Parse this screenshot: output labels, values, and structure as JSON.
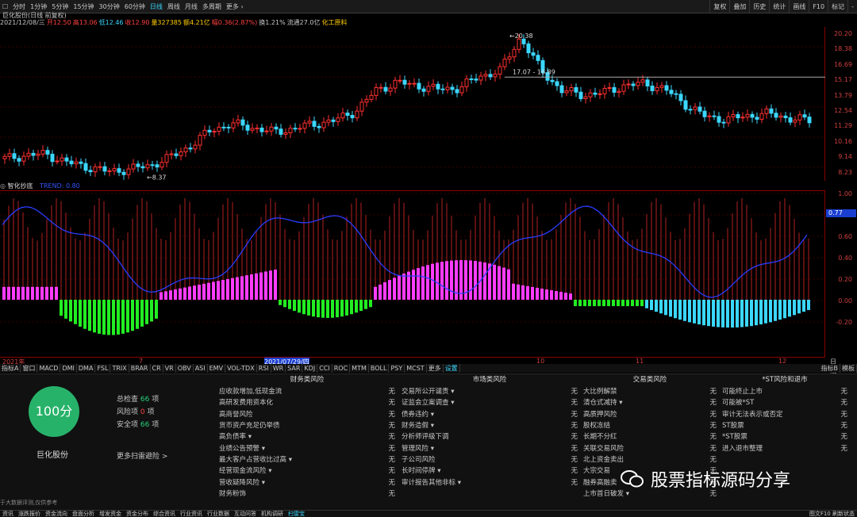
{
  "toolbar": {
    "left": [
      "分时",
      "1分钟",
      "5分钟",
      "15分钟",
      "30分钟",
      "60分钟",
      "日线",
      "周线",
      "月线",
      "多周期",
      "更多 ›"
    ],
    "right": [
      "复权",
      "叠加",
      "历史",
      "统计",
      "画线",
      "F10",
      "标记",
      "-"
    ]
  },
  "main_title": "巨化股份(日线 前复权)",
  "info": [
    "2021/12/08/三",
    "开12.50",
    "高13.06",
    "低12.46",
    "收12.90",
    "量327385",
    "额4.21亿",
    "幅0.36(2.87%)",
    "换1.21%",
    "流通27.0亿",
    "化工原料"
  ],
  "price_labels": [
    "20.20",
    "18.38",
    "16.69",
    "15.17",
    "13.79",
    "12.54",
    "11.29",
    "10.16",
    "9.14",
    "8.23"
  ],
  "price_annotations": {
    "high": "20.38",
    "low": "8.37",
    "range": "17.07 - 16.89"
  },
  "indicator_title": "智化抄底",
  "indicator_value": "TREND: 0.80",
  "ind_labels": [
    "1.00",
    "0.80",
    "0.60",
    "0.40",
    "0.20",
    "0.00",
    "-0.20"
  ],
  "ind_badge": "0.77",
  "xaxis_labels": [
    "2021年",
    "7",
    "2021/07/29/四",
    "10",
    "11",
    "12",
    "日线"
  ],
  "tabs": [
    "指标A",
    "窗口",
    "MACD",
    "DMI",
    "DMA",
    "FSL",
    "TRIX",
    "BRAR",
    "CR",
    "VR",
    "OBV",
    "ASI",
    "EMV",
    "VOL-TDX",
    "RSI",
    "WR",
    "SAR",
    "KDJ",
    "CCI",
    "ROC",
    "MTM",
    "BOLL",
    "PSY",
    "MCST",
    "更多",
    "设置"
  ],
  "tab_right": [
    "指标B",
    "模板"
  ],
  "score": "100分",
  "stock_name": "巨化股份",
  "stats": [
    {
      "label": "总检查",
      "value": "66",
      "unit": "项"
    },
    {
      "label": "风险项",
      "value": "0",
      "unit": "项"
    },
    {
      "label": "安全项",
      "value": "66",
      "unit": "项"
    }
  ],
  "more_link": "更多扫雷避险 >",
  "footnote": "于大数据评测,仅供参考",
  "risk_columns": [
    {
      "title": "财务类风险",
      "items": [
        [
          "应收款增加,低现金流",
          "无"
        ],
        [
          "高研发费用资本化",
          "无"
        ],
        [
          "高商誉风险",
          "无"
        ],
        [
          "货币资产充足仍举债",
          "无"
        ],
        [
          "高负债率 ▾",
          "无"
        ],
        [
          "业绩公告预警 ▾",
          "无"
        ],
        [
          "最大客户占营收比过高 ▾",
          "无"
        ],
        [
          "经营现金流风险 ▾",
          "无"
        ],
        [
          "营收疑降风险 ▾",
          "无"
        ],
        [
          "财务粉饰",
          "无"
        ]
      ]
    },
    {
      "title": "市场类风险",
      "items": [
        [
          "交易所公开谴责 ▾",
          "无"
        ],
        [
          "证监会立案调查 ▾",
          "无"
        ],
        [
          "债券违约 ▾",
          "无"
        ],
        [
          "财务造假 ▾",
          "无"
        ],
        [
          "分析师评级下调",
          "无"
        ],
        [
          "管理风险 ▾",
          "无"
        ],
        [
          "子公司风险",
          "无"
        ],
        [
          "长时间停牌 ▾",
          "无"
        ],
        [
          "审计报告其他非标 ▾",
          "无"
        ]
      ]
    },
    {
      "title": "交易类风险",
      "items": [
        [
          "大比例解禁",
          "无"
        ],
        [
          "清仓式减持 ▾",
          "无"
        ],
        [
          "高质押风险",
          "无"
        ],
        [
          "股权冻结",
          "无"
        ],
        [
          "长期不分红",
          "无"
        ],
        [
          "关联交易风险",
          "无"
        ],
        [
          "北上资金卖出",
          "无"
        ],
        [
          "大宗交易",
          "无"
        ],
        [
          "融券高融卖",
          "无"
        ],
        [
          "上市首日破发 ▾",
          "无"
        ]
      ]
    },
    {
      "title": "*ST风险和退市",
      "items": [
        [
          "可能终止上市",
          "无"
        ],
        [
          "可能被*ST",
          "无"
        ],
        [
          "审计无法表示或否定",
          "无"
        ],
        [
          "ST股票",
          "无"
        ],
        [
          "*ST股票",
          "无"
        ],
        [
          "进入退市整理",
          "无"
        ]
      ]
    }
  ],
  "watermark": "股票指标源码分享",
  "statusbar": [
    "资讯",
    "涨跌报价",
    "资金流向",
    "盘面分析",
    "增发资金",
    "资金分布",
    "综合资讯",
    "行业资讯",
    "行业数据",
    "互动问答",
    "机构调研",
    "扫雷宝",
    "图文F10 刷新状态"
  ],
  "chart_data": {
    "type": "candlestick",
    "title": "巨化股份(日线 前复权)",
    "annotations": [
      "20.38",
      "8.37",
      "17.07 - 16.89"
    ],
    "approx_close_path": [
      9.9,
      10.2,
      10.3,
      9.6,
      9.2,
      8.8,
      9.0,
      9.3,
      10.0,
      11.0,
      12.4,
      12.9,
      12.6,
      12.2,
      12.5,
      12.9,
      13.2,
      14.0,
      15.8,
      16.5,
      16.2,
      15.9,
      16.0,
      17.0,
      17.5,
      20.4,
      17.5,
      15.8,
      15.4,
      15.6,
      16.2,
      16.4,
      15.9,
      14.6,
      13.5,
      13.3,
      13.6,
      13.8,
      13.4,
      13.2
    ]
  }
}
